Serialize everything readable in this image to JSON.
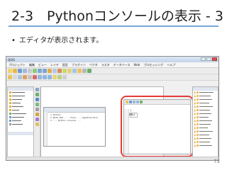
{
  "slide": {
    "title": "2-3　Pythonコンソールの表示 - 3",
    "bullet": "エディタが表示されます。",
    "page_number": "73"
  },
  "window": {
    "title": "QGIS",
    "menus": [
      "プロジェクト",
      "編集",
      "ビュー",
      "レイヤ",
      "設定",
      "プラグイン",
      "ベクタ",
      "ラスタ",
      "データベース",
      "Web",
      "プロセッシング",
      "ヘルプ"
    ]
  },
  "console": {
    "lines": [
      "1 Python",
      "2 QGIS API ... iface ... QgsInterface",
      "3 ... Python console ..."
    ]
  },
  "editor": {
    "tab_label": "無題-0",
    "first_line": "1"
  },
  "colors": {
    "highlight": "#e53a3a",
    "title_rule": "#7aa7d9"
  }
}
